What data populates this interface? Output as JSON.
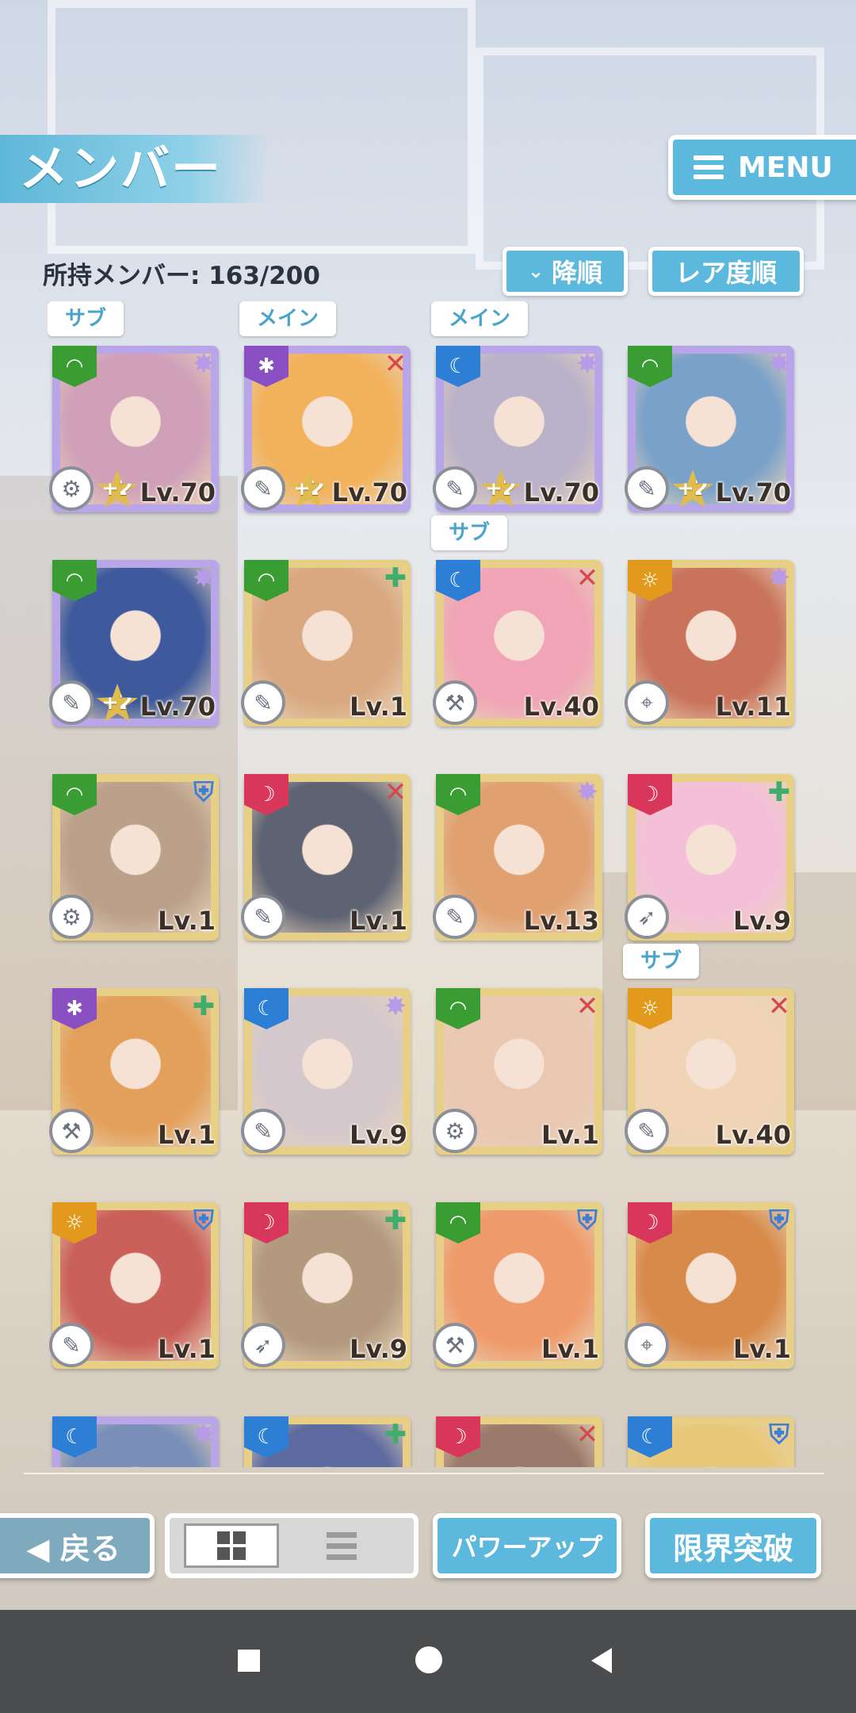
{
  "header": {
    "title": "メンバー",
    "menu_label": "MENU"
  },
  "toolbar": {
    "member_count": "所持メンバー: 163/200",
    "sort_order_label": "降順",
    "sort_rarity_label": "レア度順"
  },
  "colors": {
    "accent": "#5cb9dd",
    "attr_green": "#3a9d33",
    "attr_purple": "#8a4fc3",
    "attr_blue": "#2d7fd6",
    "attr_orange": "#e39a1c",
    "attr_red": "#d8365a"
  },
  "cards": [
    {
      "tag": "サブ",
      "attr": "green",
      "role": "star",
      "level": "Lv.70",
      "plus": "+2",
      "frame": "rainbow",
      "weapon": "gear-icon",
      "tint": "#cfa0b8"
    },
    {
      "tag": "メイン",
      "attr": "purple",
      "role": "sword",
      "level": "Lv.70",
      "plus": "+2",
      "frame": "rainbow",
      "weapon": "pen-icon",
      "tint": "#f2b25c"
    },
    {
      "tag": "メイン",
      "attr": "blue",
      "role": "star",
      "level": "Lv.70",
      "plus": "+2",
      "frame": "rainbow",
      "weapon": "pen-icon",
      "tint": "#b9b2c9"
    },
    {
      "tag": "",
      "attr": "green",
      "role": "star",
      "level": "Lv.70",
      "plus": "+2",
      "frame": "rainbow",
      "weapon": "pen-icon",
      "tint": "#7aa1c9"
    },
    {
      "tag": "",
      "attr": "green",
      "role": "star",
      "level": "Lv.70",
      "plus": "+2",
      "frame": "rainbow",
      "weapon": "pen-icon",
      "tint": "#3e5a9c"
    },
    {
      "tag": "",
      "attr": "green",
      "role": "heal",
      "level": "Lv.1",
      "plus": "",
      "frame": "gold",
      "weapon": "pen-icon",
      "tint": "#d9a880"
    },
    {
      "tag": "サブ",
      "attr": "blue",
      "role": "sword",
      "level": "Lv.40",
      "plus": "",
      "frame": "gold",
      "weapon": "axe-icon",
      "tint": "#f0a4b5"
    },
    {
      "tag": "",
      "attr": "orange",
      "role": "star",
      "level": "Lv.11",
      "plus": "",
      "frame": "gold",
      "weapon": "scope-icon",
      "tint": "#c8735a"
    },
    {
      "tag": "",
      "attr": "green",
      "role": "shield",
      "level": "Lv.1",
      "plus": "",
      "frame": "gold",
      "weapon": "gear-icon",
      "tint": "#bba08a"
    },
    {
      "tag": "",
      "attr": "red",
      "role": "sword",
      "level": "Lv.1",
      "plus": "",
      "frame": "gold",
      "weapon": "pen-icon",
      "tint": "#5e6373"
    },
    {
      "tag": "",
      "attr": "green",
      "role": "star",
      "level": "Lv.13",
      "plus": "",
      "frame": "gold",
      "weapon": "pen-icon",
      "tint": "#e0a070"
    },
    {
      "tag": "",
      "attr": "red",
      "role": "heal",
      "level": "Lv.9",
      "plus": "",
      "frame": "gold",
      "weapon": "feather-icon",
      "tint": "#f3c0d8"
    },
    {
      "tag": "",
      "attr": "purple",
      "role": "heal",
      "level": "Lv.1",
      "plus": "",
      "frame": "gold",
      "weapon": "axe-icon",
      "tint": "#e3a05a"
    },
    {
      "tag": "",
      "attr": "blue",
      "role": "star",
      "level": "Lv.9",
      "plus": "",
      "frame": "gold",
      "weapon": "pen-icon",
      "tint": "#d4c8cc"
    },
    {
      "tag": "",
      "attr": "green",
      "role": "sword",
      "level": "Lv.1",
      "plus": "",
      "frame": "gold",
      "weapon": "gear-icon",
      "tint": "#e9c7b1"
    },
    {
      "tag": "サブ",
      "attr": "orange",
      "role": "sword",
      "level": "Lv.40",
      "plus": "",
      "frame": "gold",
      "weapon": "pen-icon",
      "tint": "#f0d4b5"
    },
    {
      "tag": "",
      "attr": "orange",
      "role": "shield",
      "level": "Lv.1",
      "plus": "",
      "frame": "gold",
      "weapon": "pen-icon",
      "tint": "#c9615a"
    },
    {
      "tag": "",
      "attr": "red",
      "role": "heal",
      "level": "Lv.9",
      "plus": "",
      "frame": "gold",
      "weapon": "feather-icon",
      "tint": "#b39a7e"
    },
    {
      "tag": "",
      "attr": "green",
      "role": "shield",
      "level": "Lv.1",
      "plus": "",
      "frame": "gold",
      "weapon": "axe-icon",
      "tint": "#ef9a6a"
    },
    {
      "tag": "",
      "attr": "red",
      "role": "shield",
      "level": "Lv.1",
      "plus": "",
      "frame": "gold",
      "weapon": "scope-icon",
      "tint": "#d88a4a"
    },
    {
      "tag": "",
      "attr": "blue",
      "role": "star",
      "level": "",
      "plus": "",
      "frame": "rainbow",
      "weapon": "",
      "tint": "#7a8fb8"
    },
    {
      "tag": "",
      "attr": "blue",
      "role": "heal",
      "level": "",
      "plus": "",
      "frame": "gold",
      "weapon": "",
      "tint": "#5c6aa0"
    },
    {
      "tag": "",
      "attr": "red",
      "role": "sword",
      "level": "",
      "plus": "",
      "frame": "gold",
      "weapon": "",
      "tint": "#9a7a6a"
    },
    {
      "tag": "",
      "attr": "blue",
      "role": "shield",
      "level": "",
      "plus": "",
      "frame": "gold",
      "weapon": "",
      "tint": "#e8c878"
    }
  ],
  "bottom": {
    "back_label": "◀ 戻る",
    "power_up_label": "パワーアップ",
    "limit_break_label": "限界突破"
  }
}
